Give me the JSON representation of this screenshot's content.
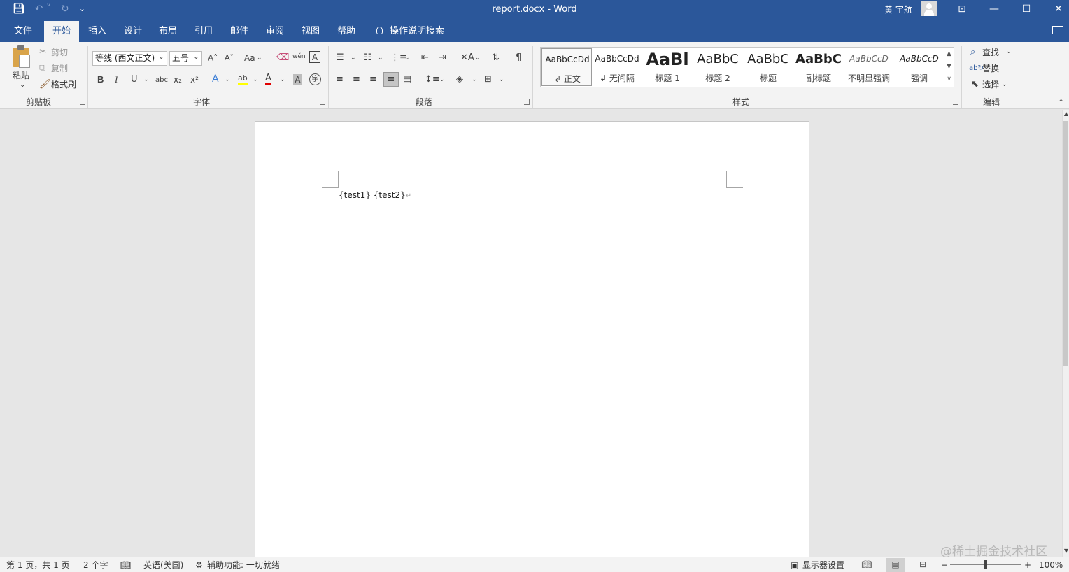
{
  "window": {
    "title": "report.docx  -  Word",
    "user_name": "黄 宇航",
    "minimize": "—",
    "maximize": "☐",
    "close": "✕",
    "ribbon_display": "⊡"
  },
  "tabs": [
    {
      "label": "文件"
    },
    {
      "label": "开始"
    },
    {
      "label": "插入"
    },
    {
      "label": "设计"
    },
    {
      "label": "布局"
    },
    {
      "label": "引用"
    },
    {
      "label": "邮件"
    },
    {
      "label": "审阅"
    },
    {
      "label": "视图"
    },
    {
      "label": "帮助"
    }
  ],
  "active_tab": "开始",
  "tell_me": "操作说明搜索",
  "clipboard": {
    "paste": "粘贴",
    "cut": "剪切",
    "copy": "复制",
    "format_painter": "格式刷",
    "group_label": "剪贴板"
  },
  "font": {
    "font_name": "等线 (西文正文)",
    "font_size": "五号",
    "group_label": "字体",
    "bold": "B",
    "italic": "I",
    "underline": "U",
    "strikethrough": "abc",
    "subscript": "x₂",
    "superscript": "x²",
    "grow": "A˄",
    "shrink": "A˅",
    "change_case": "Aa",
    "phonetic": "wén",
    "char_border": "A",
    "text_effects": "A",
    "highlight": "ab",
    "font_color": "A",
    "char_shading": "A",
    "enclose": "字"
  },
  "paragraph": {
    "group_label": "段落"
  },
  "styles": {
    "group_label": "样式",
    "items": [
      {
        "preview": "AaBbCcDd",
        "name": "↲ 正文"
      },
      {
        "preview": "AaBbCcDd",
        "name": "↲ 无间隔"
      },
      {
        "preview": "AaBl",
        "name": "标题 1"
      },
      {
        "preview": "AaBbC",
        "name": "标题 2"
      },
      {
        "preview": "AaBbC",
        "name": "标题"
      },
      {
        "preview": "AaBbC",
        "name": "副标题"
      },
      {
        "preview": "AaBbCcD",
        "name": "不明显强调"
      },
      {
        "preview": "AaBbCcD",
        "name": "强调"
      }
    ]
  },
  "editing": {
    "find": "查找",
    "replace": "替换",
    "select": "选择",
    "group_label": "编辑"
  },
  "document": {
    "text": "{test1} {test2}",
    "paragraph_mark": "↵"
  },
  "watermark": "@稀土掘金技术社区",
  "status": {
    "page": "第 1 页，共 1 页",
    "words": "2 个字",
    "language": "英语(美国)",
    "accessibility": "辅助功能: 一切就绪",
    "display_settings": "显示器设置",
    "zoom": "100%",
    "zoom_minus": "−",
    "zoom_plus": "+"
  }
}
